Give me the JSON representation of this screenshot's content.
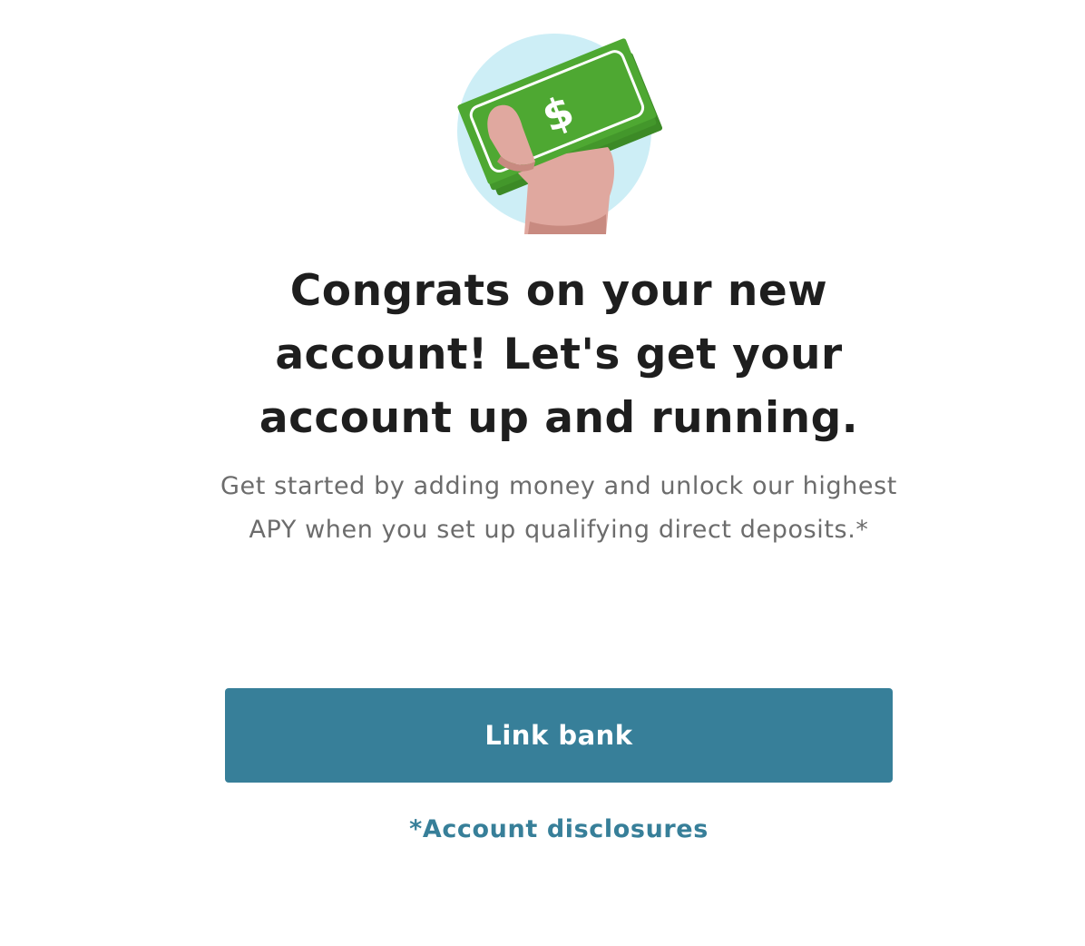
{
  "illustration": {
    "icon": "money-in-hand-icon",
    "symbol": "$",
    "colors": {
      "circle": "#cdeef6",
      "bill": "#4ea832",
      "bill_dark": "#3c8a26",
      "skin": "#e0a89f",
      "skin_shadow": "#c88a80"
    }
  },
  "headline": "Congrats on your new account! Let's get your account up and running.",
  "subtext": "Get started by adding money and unlock our highest APY when you set up qualifying direct deposits.*",
  "primary_button": {
    "label": "Link bank",
    "color": "#377f99"
  },
  "disclosure_link": {
    "label": "*Account disclosures",
    "color": "#377f99"
  }
}
